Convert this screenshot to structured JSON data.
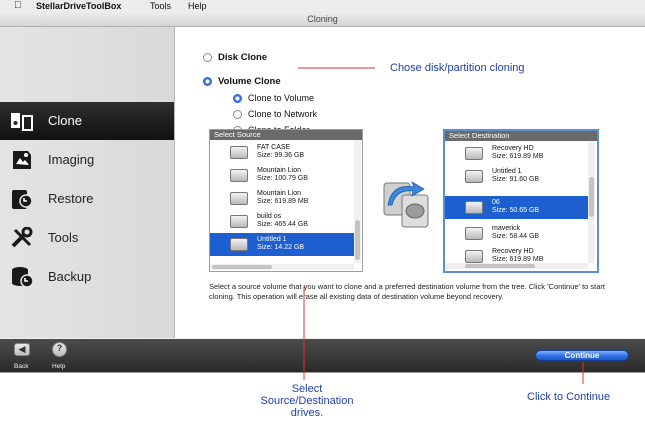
{
  "menubar": {
    "apple": "",
    "app_name": "StellarDriveToolBox",
    "menu_tools": "Tools",
    "menu_help": "Help"
  },
  "window": {
    "title": "Cloning"
  },
  "sidebar": {
    "items": [
      {
        "label": "Clone",
        "icon": "clone-icon",
        "active": true
      },
      {
        "label": "Imaging",
        "icon": "imaging-icon",
        "active": false
      },
      {
        "label": "Restore",
        "icon": "restore-icon",
        "active": false
      },
      {
        "label": "Tools",
        "icon": "tools-icon",
        "active": false
      },
      {
        "label": "Backup",
        "icon": "backup-icon",
        "active": false
      }
    ]
  },
  "options": {
    "disk_clone": "Disk Clone",
    "volume_clone": "Volume Clone",
    "clone_to_volume": "Clone to Volume",
    "clone_to_network": "Clone to Network",
    "clone_to_folder": "Clone to Folder",
    "selected": "volume_clone",
    "selected_sub": "clone_to_volume"
  },
  "source": {
    "header": "Select Source",
    "rows": [
      {
        "name": "FAT CASE",
        "size": "Size: 99.36 GB",
        "selected": false
      },
      {
        "name": "Mountain Lion",
        "size": "Size: 100.79 GB",
        "selected": false
      },
      {
        "name": "Mountain Lion",
        "size": "Size: 619.89 MB",
        "selected": false
      },
      {
        "name": "build os",
        "size": "Size: 465.44 GB",
        "selected": false
      },
      {
        "name": "Untitled 1",
        "size": "Size: 14.22 GB",
        "selected": true
      }
    ]
  },
  "destination": {
    "header": "Select Destination",
    "rows": [
      {
        "name": "Recovery HD",
        "size": "Size: 619.89 MB",
        "selected": false
      },
      {
        "name": "Untitled 1",
        "size": "Size: 91.60 GB",
        "selected": false
      },
      {
        "name": "06",
        "size": "Size: 50.65 GB",
        "selected": true
      },
      {
        "name": "maverick",
        "size": "Size: 58.44 GB",
        "selected": false
      },
      {
        "name": "Recovery HD",
        "size": "Size: 619.89 MB",
        "selected": false
      }
    ]
  },
  "description": "Select a source volume that you want to clone and a preferred destination volume from the tree. Click 'Continue' to start cloning. This operation will erase all existing data of destination volume beyond recovery.",
  "bottom": {
    "back_label": "Back",
    "help_label": "Help",
    "help_glyph": "?",
    "continue_label": "Continue"
  },
  "annotations": {
    "chose_cloning": "Chose disk/partition cloning",
    "select_drives_1": "Select",
    "select_drives_2": "Source/Destination",
    "select_drives_3": "drives.",
    "click_continue": "Click to Continue",
    "color": "#1f3fb0",
    "line_color": "#e03030"
  }
}
